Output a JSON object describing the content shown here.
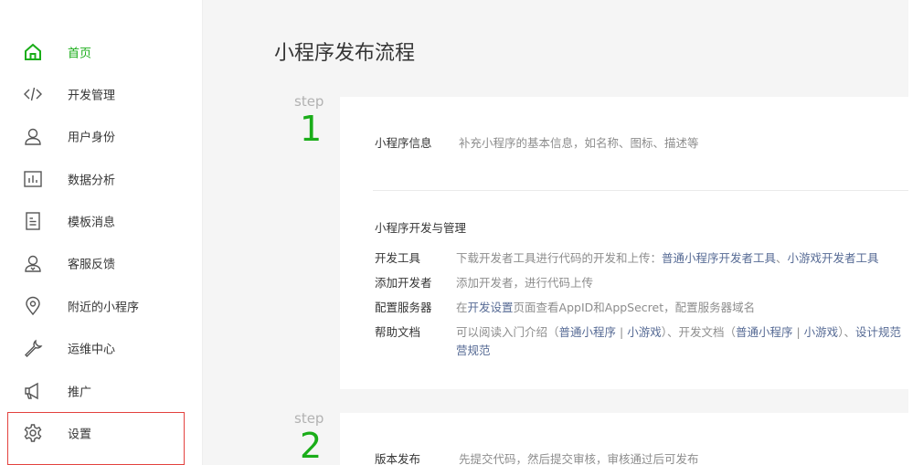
{
  "sidebar": {
    "items": [
      {
        "label": "首页",
        "icon": "home-icon"
      },
      {
        "label": "开发管理",
        "icon": "code-icon"
      },
      {
        "label": "用户身份",
        "icon": "user-icon"
      },
      {
        "label": "数据分析",
        "icon": "chart-icon"
      },
      {
        "label": "模板消息",
        "icon": "document-icon"
      },
      {
        "label": "客服反馈",
        "icon": "support-user-icon"
      },
      {
        "label": "附近的小程序",
        "icon": "location-pin-icon"
      },
      {
        "label": "运维中心",
        "icon": "wrench-icon"
      },
      {
        "label": "推广",
        "icon": "megaphone-icon"
      },
      {
        "label": "设置",
        "icon": "gear-icon"
      }
    ],
    "active_index": 0,
    "accent_color": "#1aad19",
    "highlight_color": "#e3413e"
  },
  "main": {
    "title": "小程序发布流程",
    "step_word": "step",
    "step1": {
      "number": "1",
      "info_label": "小程序信息",
      "info_desc": "补充小程序的基本信息，如名称、图标、描述等",
      "section_title": "小程序开发与管理",
      "rows": {
        "dev_tools": {
          "label": "开发工具",
          "desc": "下载开发者工具进行代码的开发和上传：",
          "link1": "普通小程序开发者工具",
          "sep": "、",
          "link2": "小游戏开发者工具"
        },
        "add_dev": {
          "label": "添加开发者",
          "desc": "添加开发者，进行代码上传"
        },
        "server": {
          "label": "配置服务器",
          "pre": "在",
          "link": "开发设置",
          "desc": "页面查看AppID和AppSecret，配置服务器域名"
        },
        "help": {
          "label": "帮助文档",
          "desc1": "可以阅读入门介绍（",
          "link1": "普通小程序",
          "bar1": " | ",
          "link2": "小游戏",
          "desc2": "）、开发文档（",
          "link3": "普通小程序",
          "bar2": " | ",
          "link4": "小游戏",
          "desc3": "）、",
          "link5": "设计规范",
          "link6": "营规范"
        }
      }
    },
    "step2": {
      "number": "2",
      "label": "版本发布",
      "desc": "先提交代码，然后提交审核，审核通过后可发布"
    }
  },
  "colors": {
    "link": "#576b95",
    "accent": "#1aad19",
    "muted": "#8d8d8d",
    "background": "#f5f5f5"
  }
}
